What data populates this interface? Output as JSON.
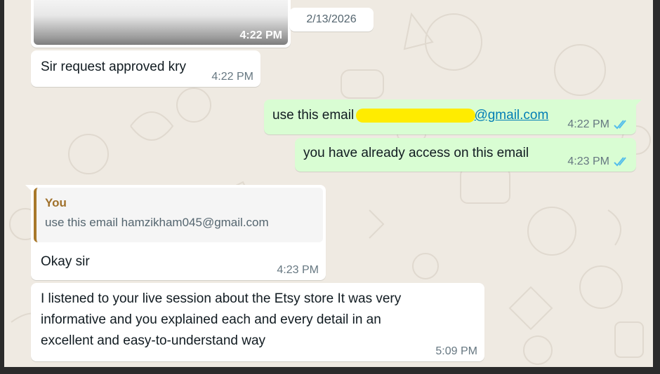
{
  "chat": {
    "date_chip": "2/13/2026",
    "messages": [
      {
        "type": "image",
        "direction": "in",
        "time": "4:22 PM"
      },
      {
        "type": "text",
        "direction": "in",
        "text": "Sir request approved kry",
        "time": "4:22 PM"
      },
      {
        "type": "text",
        "direction": "out",
        "text_prefix": "use this email ",
        "link_visible": "@gmail.com",
        "redacted": true,
        "time": "4:22 PM",
        "status": "read",
        "ticks_icon": "double-check-icon"
      },
      {
        "type": "text",
        "direction": "out",
        "text": "you have already access on this email",
        "time": "4:23 PM",
        "status": "read",
        "ticks_icon": "double-check-icon"
      },
      {
        "type": "reply",
        "direction": "in",
        "quote": {
          "author": "You",
          "text": "use this email hamzikham045@gmail.com"
        },
        "text": "Okay sir",
        "time": "4:23 PM"
      },
      {
        "type": "text",
        "direction": "in",
        "lines": [
          "I listened to your live session about the Etsy store It was very",
          "informative and you explained each and every detail in an",
          "excellent and easy-to-understand way"
        ],
        "time": "5:09 PM"
      }
    ]
  },
  "colors": {
    "wallpaper": "#efeae2",
    "incoming_bubble": "#ffffff",
    "outgoing_bubble": "#d9fdd3",
    "read_ticks": "#53bdeb",
    "link": "#027eb5",
    "quote_author": "#a0712b",
    "redaction": "#ffec00"
  }
}
